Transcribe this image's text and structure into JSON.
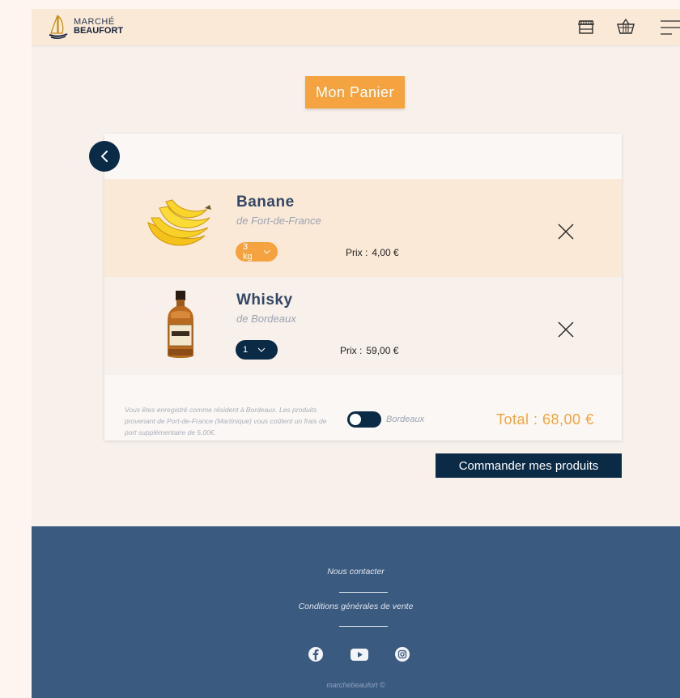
{
  "brand": {
    "line1": "MARCHÉ",
    "line2": "BEAUFORT"
  },
  "header": {
    "icons": [
      "store-icon",
      "basket-icon",
      "menu-icon"
    ]
  },
  "page_title": "Mon Panier",
  "cart": {
    "items": [
      {
        "name": "Banane",
        "origin": "de Fort-de-France",
        "quantity": "3 kg",
        "price_label": "Prix :",
        "price": "4,00 €",
        "image": "banana"
      },
      {
        "name": "Whisky",
        "origin": "de Bordeaux",
        "quantity": "1",
        "price_label": "Prix :",
        "price": "59,00 €",
        "image": "whisky-bottle"
      }
    ],
    "note": "Vous êtes enregistré comme résident à Bordeaux. Les produits provenant de Port-de-France (Martinique) vous coûtent un frais de port supplémentaire de 5,00€.",
    "toggle_label": "Bordeaux",
    "total": "Total : 68,00 €"
  },
  "order_button": "Commander mes produits",
  "footer": {
    "contact": "Nous contacter",
    "terms": "Conditions générales de vente",
    "social": [
      "facebook-icon",
      "youtube-icon",
      "instagram-icon"
    ],
    "copyright": "marchebeaufort ©"
  },
  "colors": {
    "accent": "#f4a340",
    "navy": "#0b2a46",
    "footer": "#3b5a80",
    "text": "#334765"
  }
}
